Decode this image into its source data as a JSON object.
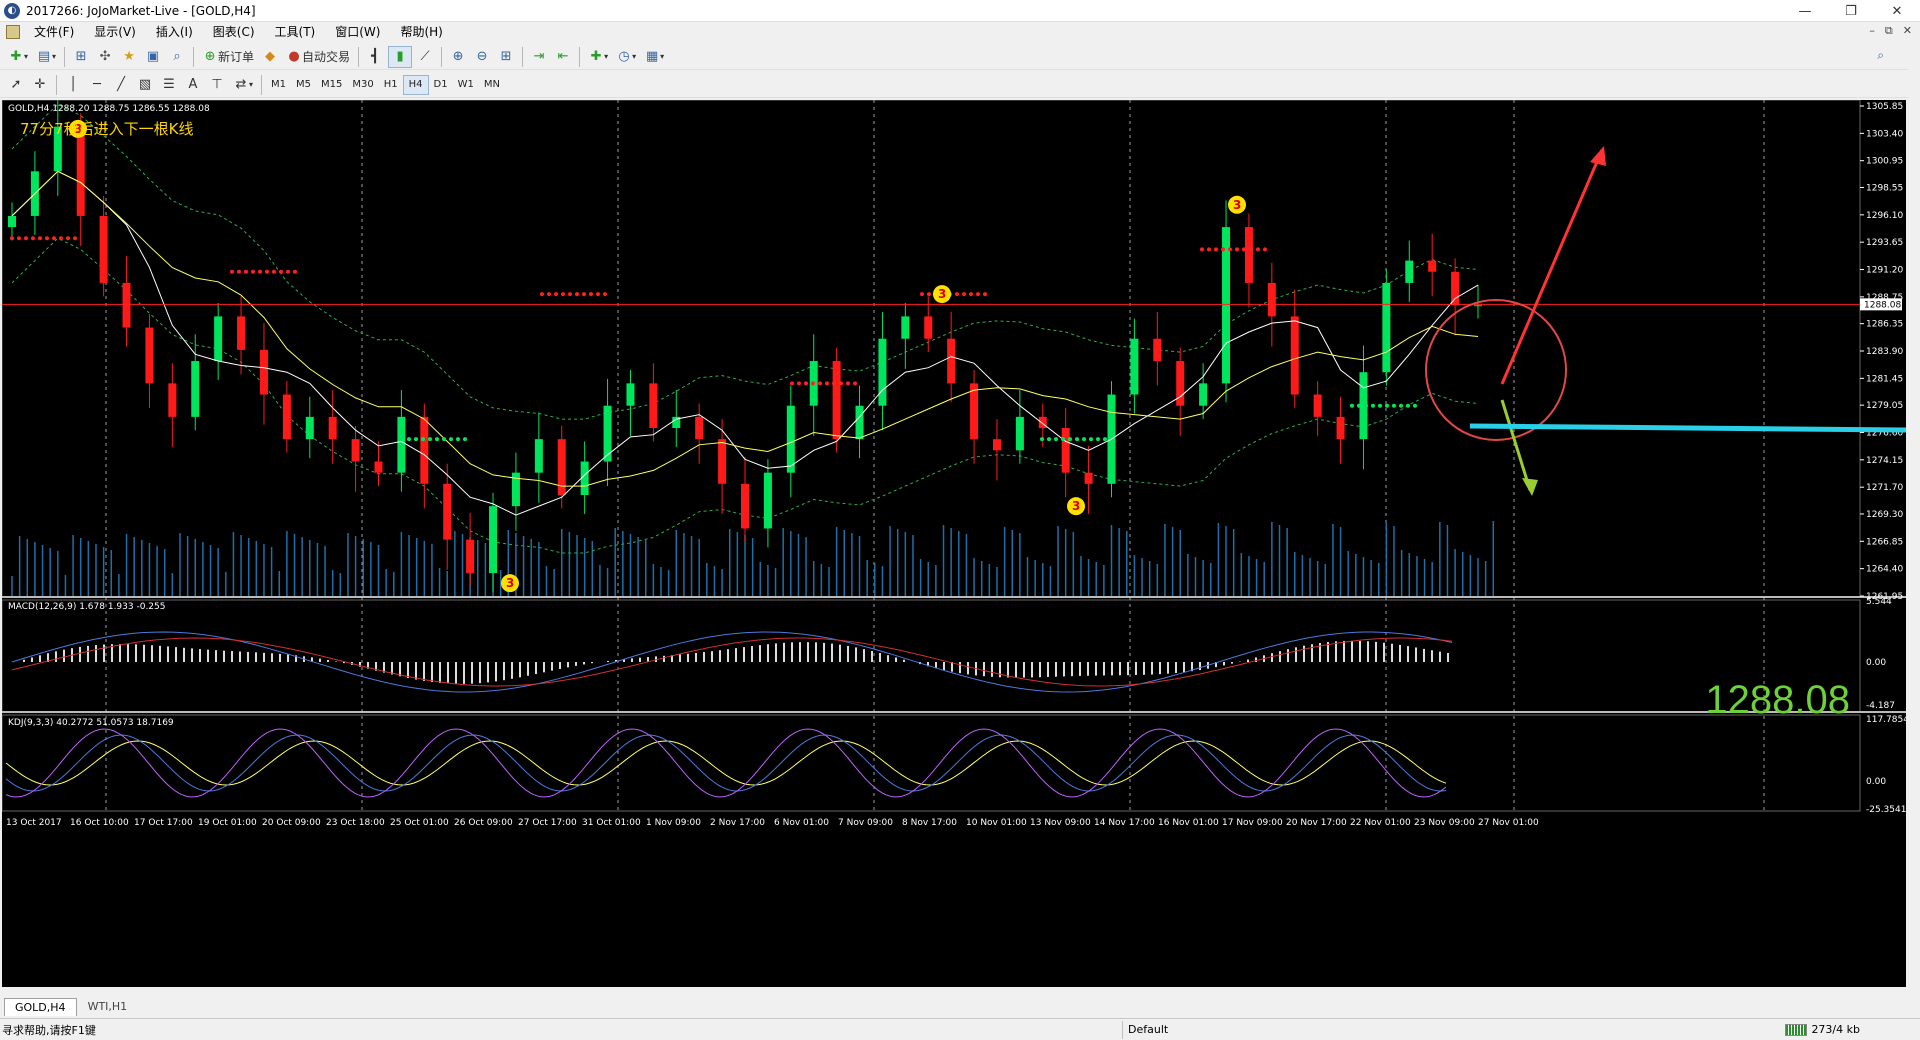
{
  "window": {
    "title": "2017266: JoJoMarket-Live - [GOLD,H4]",
    "controls": [
      "—",
      "❐",
      "✕"
    ]
  },
  "menu": {
    "items": [
      "文件(F)",
      "显示(V)",
      "插入(I)",
      "图表(C)",
      "工具(T)",
      "窗口(W)",
      "帮助(H)"
    ]
  },
  "toolbar": {
    "new_order_label": "新订单",
    "auto_trading_label": "自动交易"
  },
  "timeframes": {
    "items": [
      "M1",
      "M5",
      "M15",
      "M30",
      "H1",
      "H4",
      "D1",
      "W1",
      "MN"
    ],
    "active": "H4"
  },
  "chart": {
    "symbol_info": "GOLD,H4  1288.20 1288.75 1286.55 1288.08",
    "notice": "77分7秒后进入下一根K线",
    "current_price_big": "1288.08",
    "current_price_tag": "1288.08",
    "price_ticks": [
      "1305.85",
      "1303.40",
      "1300.95",
      "1298.55",
      "1296.10",
      "1293.65",
      "1291.20",
      "1288.75",
      "1286.35",
      "1283.90",
      "1281.45",
      "1279.05",
      "1276.60",
      "1274.15",
      "1271.70",
      "1269.30",
      "1266.85",
      "1264.40",
      "1261.95"
    ],
    "macd_label": "MACD(12,26,9) 1.678 1.933 -0.255",
    "macd_ticks": [
      "5.544",
      "0.00",
      "-4.187"
    ],
    "kdj_label": "KDJ(9,3,3) 40.2772 51.0573 18.7169",
    "kdj_ticks": [
      "117.7854",
      "0.00",
      "-25.3541"
    ],
    "time_labels": [
      "13 Oct 2017",
      "16 Oct 10:00",
      "17 Oct 17:00",
      "19 Oct 01:00",
      "20 Oct 09:00",
      "23 Oct 18:00",
      "25 Oct 01:00",
      "26 Oct 09:00",
      "27 Oct 17:00",
      "31 Oct 01:00",
      "1 Nov 09:00",
      "2 Nov 17:00",
      "6 Nov 01:00",
      "7 Nov 09:00",
      "8 Nov 17:00",
      "10 Nov 01:00",
      "13 Nov 09:00",
      "14 Nov 17:00",
      "16 Nov 01:00",
      "17 Nov 09:00",
      "20 Nov 17:00",
      "22 Nov 01:00",
      "23 Nov 09:00",
      "27 Nov 01:00"
    ],
    "signal_markers": [
      "3",
      "3",
      "3",
      "3",
      "3"
    ],
    "colors": {
      "background": "#000000",
      "bull": "#00e65c",
      "bear": "#ff1a1a",
      "ma_fast": "#ffffff",
      "ma_slow": "#ffff66",
      "band": "#2fae4b",
      "price_line": "#ff2020",
      "volume": "#1e6fa8",
      "arrow_up": "#ff3333",
      "arrow_down": "#9acd32",
      "arrow_horizontal": "#2ad0e8",
      "marker": "#ffe000"
    }
  },
  "chart_data": {
    "type": "candlestick",
    "title": "GOLD,H4",
    "ylim": [
      1261.95,
      1305.85
    ],
    "series_close_approx": [
      1296,
      1300,
      1304,
      1296,
      1290,
      1286,
      1281,
      1278,
      1283,
      1287,
      1284,
      1280,
      1276,
      1278,
      1276,
      1274,
      1273,
      1278,
      1272,
      1267,
      1264,
      1270,
      1273,
      1276,
      1271,
      1274,
      1279,
      1281,
      1277,
      1278,
      1276,
      1272,
      1268,
      1273,
      1279,
      1283,
      1276,
      1279,
      1285,
      1287,
      1285,
      1281,
      1276,
      1275,
      1278,
      1277,
      1273,
      1272,
      1280,
      1285,
      1283,
      1279,
      1281,
      1295,
      1290,
      1287,
      1280,
      1278,
      1276,
      1282,
      1290,
      1292,
      1291,
      1288,
      1288
    ],
    "x_range": [
      "13 Oct 2017",
      "27 Nov 01:00"
    ]
  },
  "tabs": {
    "items": [
      "GOLD,H4",
      "WTI,H1"
    ],
    "active": "GOLD,H4"
  },
  "status": {
    "help": "寻求帮助,请按F1键",
    "profile": "Default",
    "connection": "273/4 kb"
  }
}
